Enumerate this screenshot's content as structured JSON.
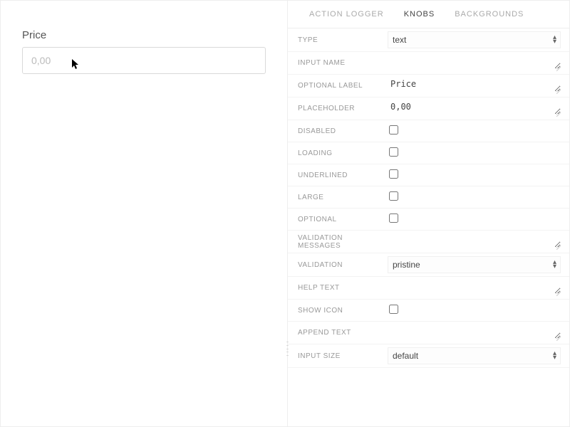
{
  "preview": {
    "label": "Price",
    "placeholder": "0,00",
    "value": ""
  },
  "tabs": [
    {
      "label": "ACTION LOGGER",
      "active": false
    },
    {
      "label": "KNOBS",
      "active": true
    },
    {
      "label": "BACKGROUNDS",
      "active": false
    }
  ],
  "knobs": {
    "type": {
      "label": "TYPE",
      "value": "text"
    },
    "input_name": {
      "label": "INPUT NAME",
      "value": ""
    },
    "optional_label": {
      "label": "OPTIONAL LABEL",
      "value": "Price"
    },
    "placeholder": {
      "label": "PLACEHOLDER",
      "value": "0,00"
    },
    "disabled": {
      "label": "DISABLED",
      "checked": false
    },
    "loading": {
      "label": "LOADING",
      "checked": false
    },
    "underlined": {
      "label": "UNDERLINED",
      "checked": false
    },
    "large": {
      "label": "LARGE",
      "checked": false
    },
    "optional": {
      "label": "OPTIONAL",
      "checked": false
    },
    "validation_messages": {
      "label": "VALIDATION MESSAGES",
      "value": ""
    },
    "validation": {
      "label": "VALIDATION",
      "value": "pristine"
    },
    "help_text": {
      "label": "HELP TEXT",
      "value": ""
    },
    "show_icon": {
      "label": "SHOW ICON",
      "checked": false
    },
    "append_text": {
      "label": "APPEND TEXT",
      "value": ""
    },
    "input_size": {
      "label": "INPUT SIZE",
      "value": "default"
    }
  }
}
